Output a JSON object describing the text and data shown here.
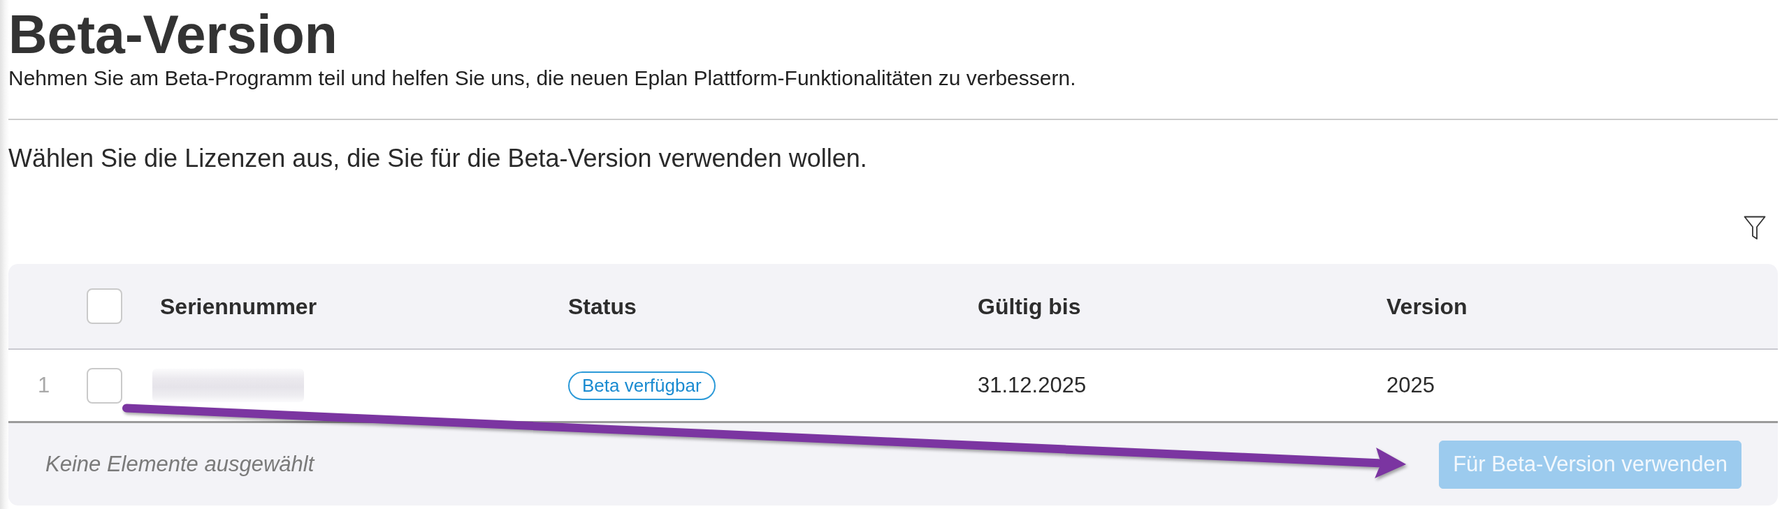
{
  "page": {
    "title": "Beta-Version",
    "subtitle": "Nehmen Sie am Beta-Programm teil und helfen Sie uns, die neuen Eplan Plattform-Funktionalitäten zu verbessern.",
    "instruction": "Wählen Sie die Lizenzen aus, die Sie für die Beta-Version verwenden wollen."
  },
  "table": {
    "select_all": {
      "checked": false
    },
    "columns": [
      "Seriennummer",
      "Status",
      "Gültig bis",
      "Version"
    ],
    "rows": [
      {
        "number": "1",
        "checked": false,
        "status": "Beta verfügbar",
        "valid_until": "31.12.2025",
        "version": "2025"
      }
    ]
  },
  "footer": {
    "selection_info": "Keine Elemente ausgewählt",
    "action_button": {
      "label": "Für Beta-Version verwenden",
      "disabled": true
    }
  }
}
